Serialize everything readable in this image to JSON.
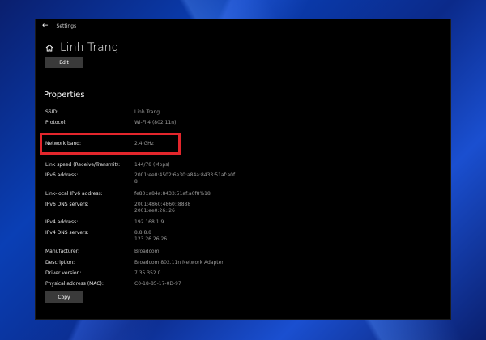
{
  "window": {
    "title": "Settings",
    "back_icon": "back-arrow-icon"
  },
  "header": {
    "icon": "home-icon",
    "network_name": "Linh Trang"
  },
  "buttons": {
    "edit_label": "Edit",
    "copy_label": "Copy"
  },
  "properties": {
    "section_title": "Properties",
    "rows": [
      {
        "label": "SSID:",
        "value": "Linh Trang"
      },
      {
        "label": "Protocol:",
        "value": "Wi-Fi 4 (802.11n)"
      },
      {
        "label": "Network band:",
        "value": "2.4 GHz"
      },
      {
        "label": "Link speed (Receive/Transmit):",
        "value": "144/78 (Mbps)"
      },
      {
        "label": "IPv6 address:",
        "value": "2001:ee0:4502:6e30:a84a:8433:51af:a0f\n8"
      },
      {
        "label": "Link-local IPv6 address:",
        "value": "fe80::a84a:8433:51af:a0f8%18"
      },
      {
        "label": "IPv6 DNS servers:",
        "value": "2001:4860:4860::8888\n2001:ee0:26::26"
      },
      {
        "label": "IPv4 address:",
        "value": "192.168.1.9"
      },
      {
        "label": "IPv4 DNS servers:",
        "value": "8.8.8.8\n123.26.26.26"
      },
      {
        "label": "Manufacturer:",
        "value": "Broadcom"
      },
      {
        "label": "Description:",
        "value": "Broadcom 802.11n Network Adapter"
      },
      {
        "label": "Driver version:",
        "value": "7.35.352.0"
      },
      {
        "label": "Physical address (MAC):",
        "value": "C0-18-85-17-0D-97"
      }
    ]
  },
  "colors": {
    "highlight": "#e3262c",
    "window_bg": "#000000",
    "desktop_accent": "#0a3fb5"
  }
}
